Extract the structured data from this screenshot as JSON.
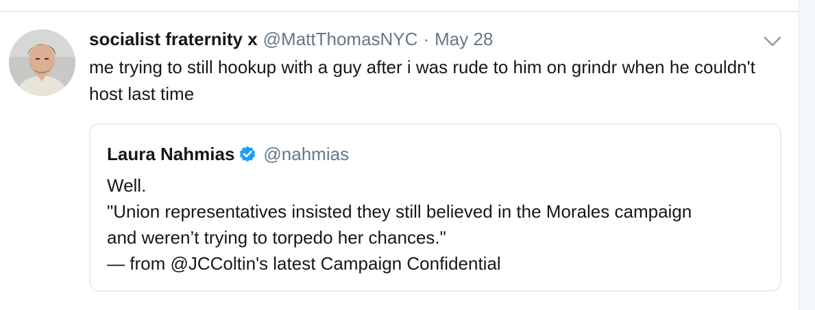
{
  "tweet": {
    "display_name": "socialist fraternity x",
    "handle": "@MattThomasNYC",
    "separator": "·",
    "date": "May 28",
    "text": "me trying to still hookup with a guy after i was rude to him on grindr when he couldn't host last time"
  },
  "quoted_tweet": {
    "display_name": "Laura Nahmias",
    "verified": true,
    "handle": "@nahmias",
    "lines": [
      "Well.",
      "\"Union representatives insisted they still believed in the Morales campaign",
      "and weren’t trying to torpedo her chances.\"",
      "— from @JCColtin's latest Campaign Confidential"
    ]
  },
  "icons": {
    "caret": "chevron-down-icon",
    "verified": "verified-badge-icon"
  },
  "colors": {
    "text_primary": "#14171a",
    "text_secondary": "#657786",
    "border": "#e6ecf0",
    "verified_blue": "#1da1f2"
  }
}
